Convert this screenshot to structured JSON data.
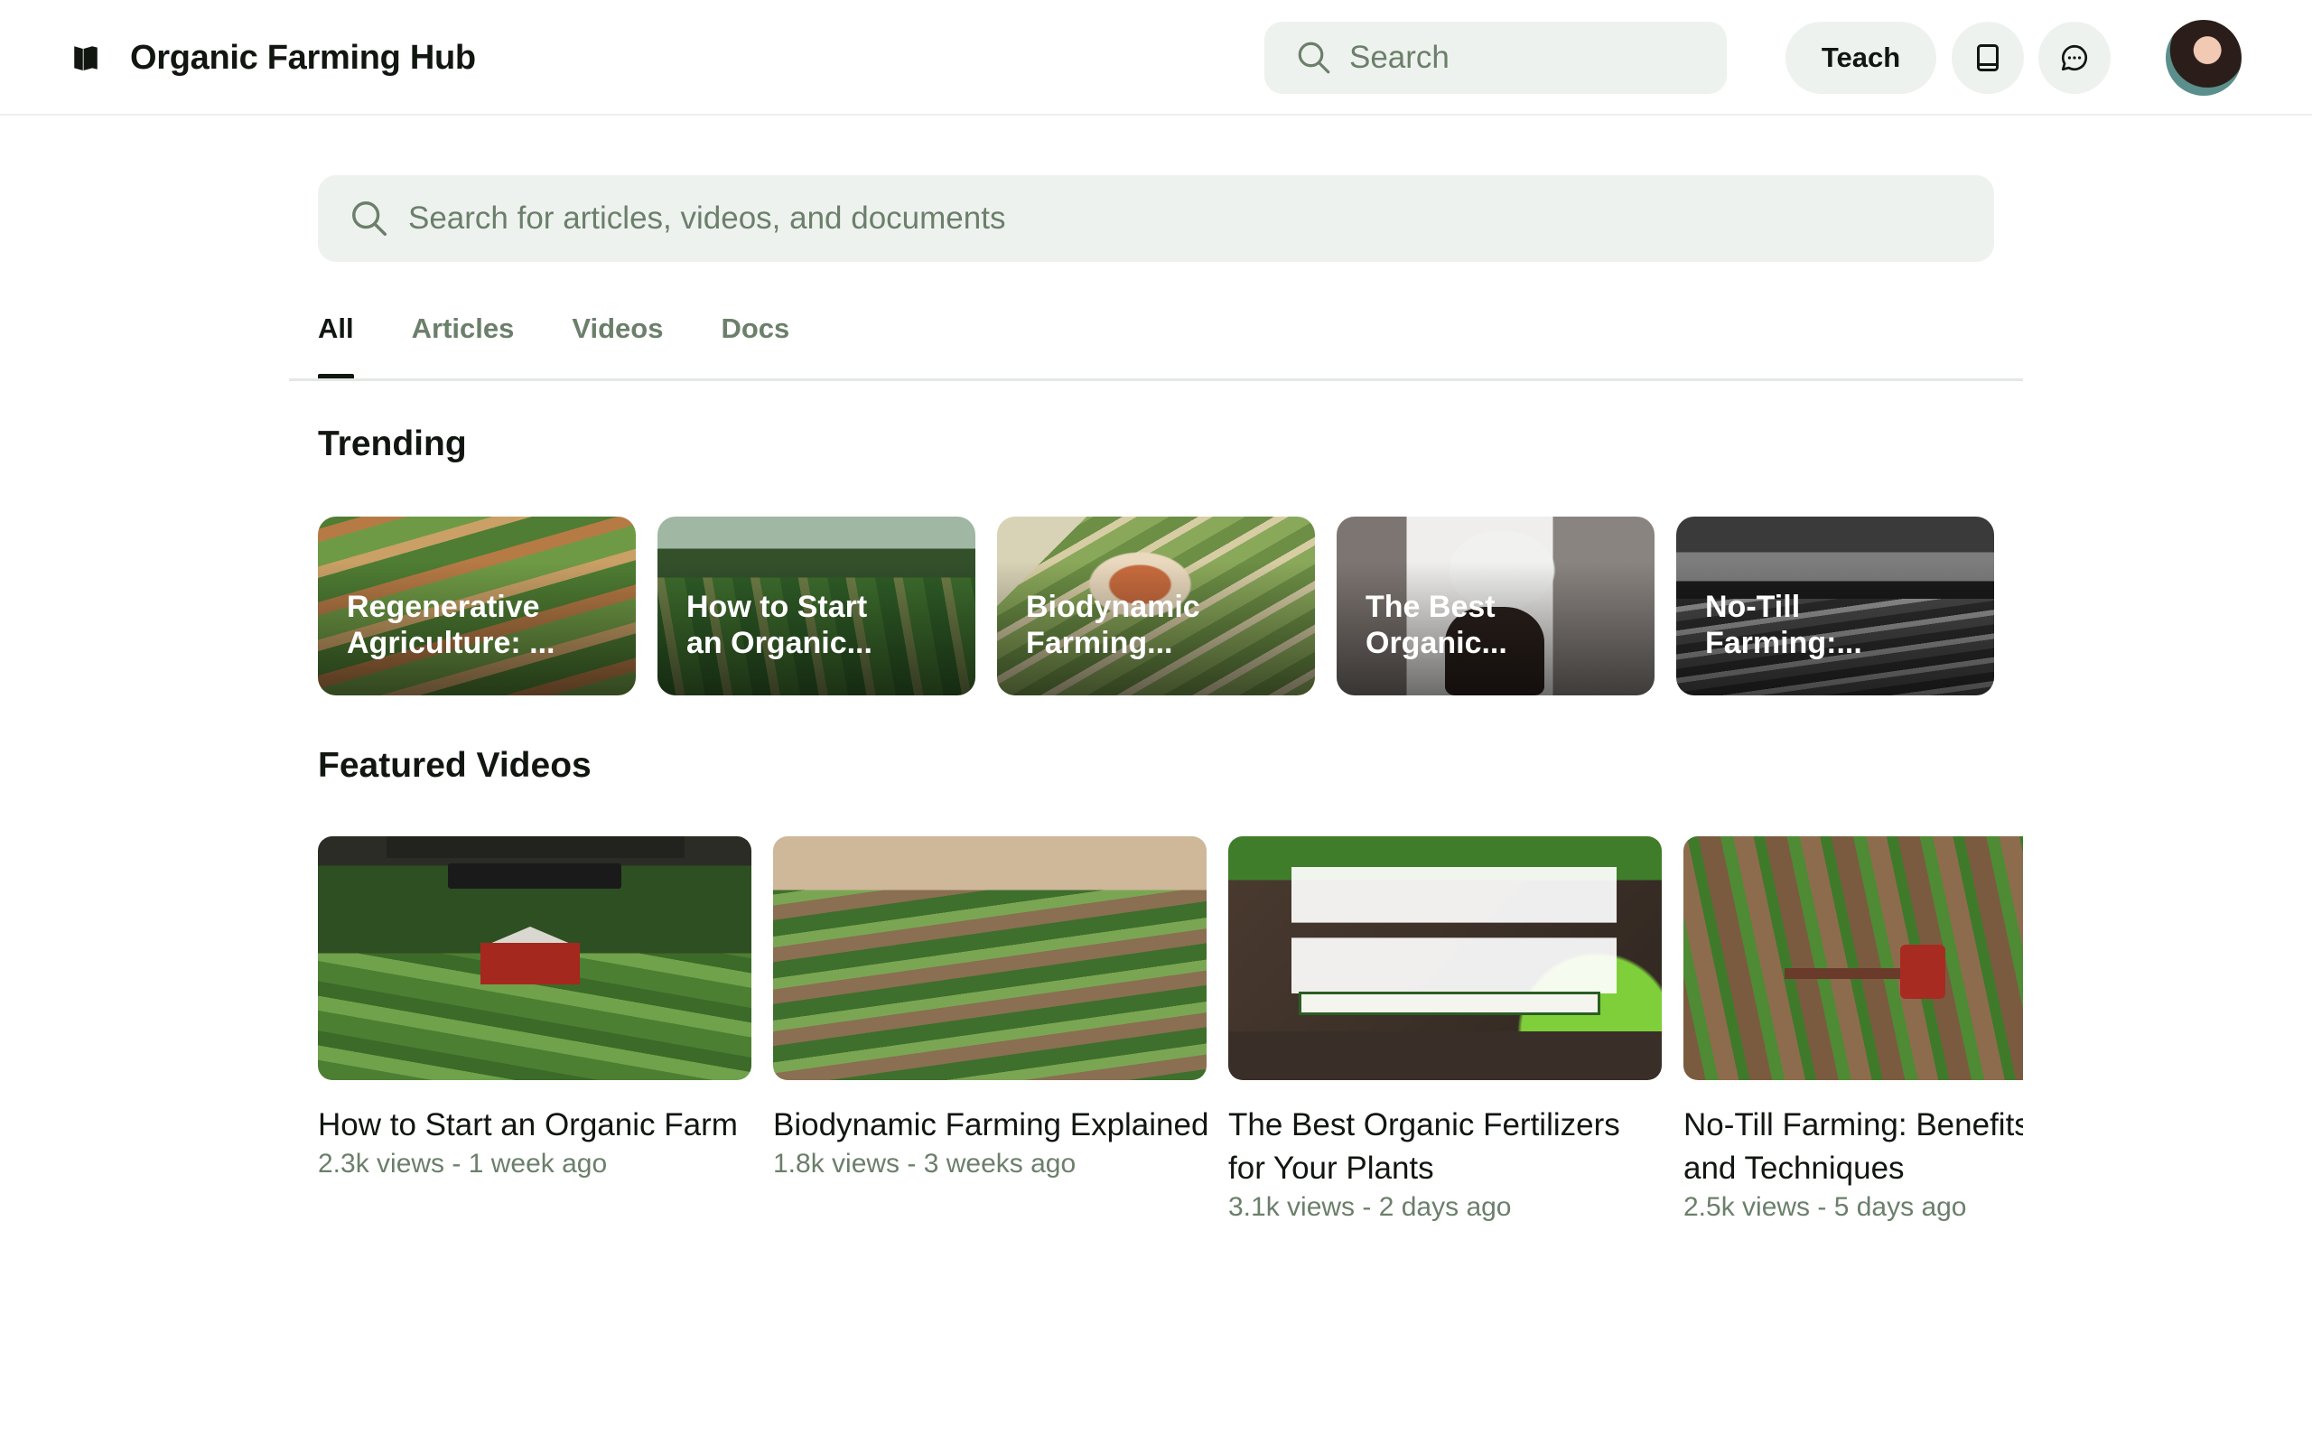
{
  "header": {
    "brand_name": "Organic Farming Hub",
    "search_placeholder": "Search",
    "teach_label": "Teach",
    "icons": [
      "book-icon",
      "chat-icon"
    ]
  },
  "main": {
    "search_placeholder": "Search for articles, videos, and documents",
    "tabs": [
      {
        "label": "All",
        "active": true
      },
      {
        "label": "Articles",
        "active": false
      },
      {
        "label": "Videos",
        "active": false
      },
      {
        "label": "Docs",
        "active": false
      }
    ],
    "trending": {
      "title": "Trending",
      "items": [
        {
          "title": "Regenerative\nAgriculture: ..."
        },
        {
          "title": "How to Start\nan Organic..."
        },
        {
          "title": "Biodynamic\nFarming..."
        },
        {
          "title": "The Best\nOrganic..."
        },
        {
          "title": "No-Till\nFarming:..."
        }
      ]
    },
    "featured": {
      "title": "Featured Videos",
      "items": [
        {
          "title": "How to Start an Organic Farm",
          "meta": "2.3k views - 1 week ago"
        },
        {
          "title": "Biodynamic Farming Explained",
          "meta": "1.8k views - 3 weeks ago"
        },
        {
          "title": "The Best Organic Fertilizers for Your Plants",
          "meta": "3.1k views - 2 days ago"
        },
        {
          "title": "No-Till Farming: Benefits and Techniques",
          "meta": "2.5k views - 5 days ago"
        }
      ]
    }
  },
  "colors": {
    "muted_green": "#6b7f6b",
    "surface": "#eef2ee",
    "text": "#111611"
  }
}
